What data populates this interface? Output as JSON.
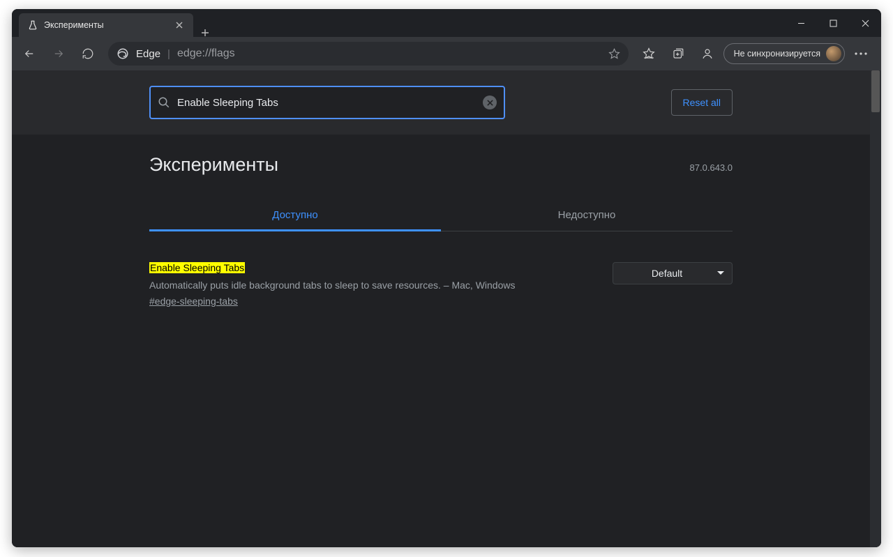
{
  "tab": {
    "title": "Эксперименты"
  },
  "address": {
    "brand": "Edge",
    "url": "edge://flags"
  },
  "profile": {
    "label": "Не синхронизируется"
  },
  "search": {
    "value": "Enable Sleeping Tabs"
  },
  "reset_label": "Reset all",
  "page": {
    "title": "Эксперименты",
    "version": "87.0.643.0",
    "tab_available": "Доступно",
    "tab_unavailable": "Недоступно"
  },
  "experiment": {
    "title": "Enable Sleeping Tabs",
    "description": "Automatically puts idle background tabs to sleep to save resources. – Mac, Windows",
    "anchor": "#edge-sleeping-tabs",
    "selected": "Default"
  }
}
